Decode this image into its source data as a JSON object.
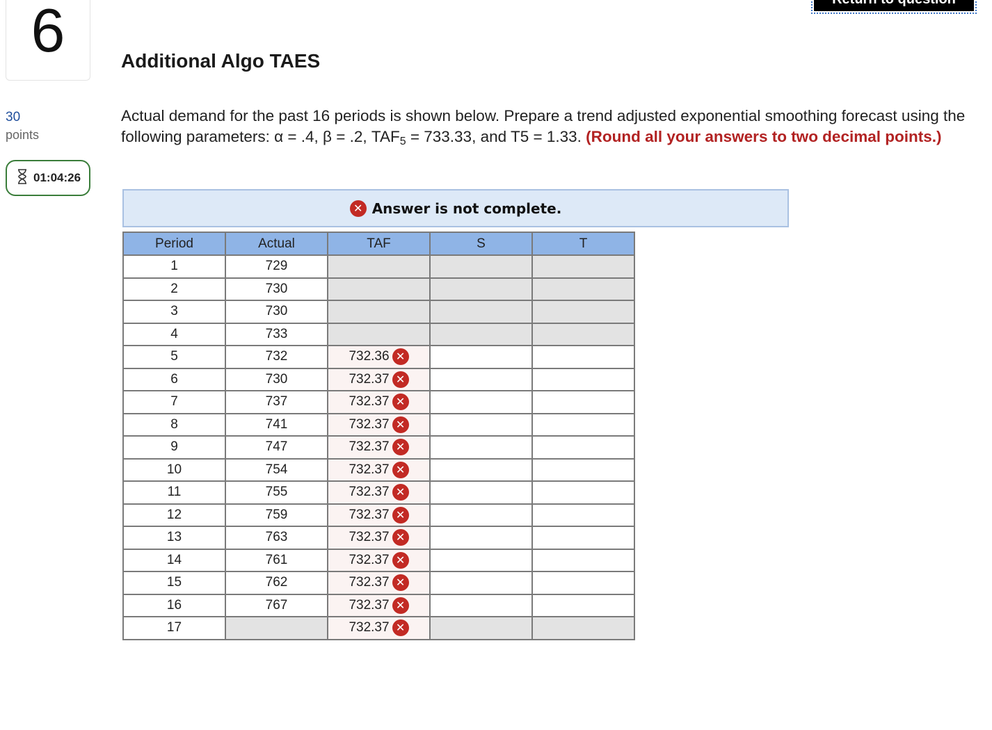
{
  "question": {
    "number": "6",
    "points_value": "30",
    "points_label": "points",
    "timer": "01:04:26",
    "title": "Additional Algo TAES",
    "prompt_main": "Actual demand for the past 16 periods is shown below. Prepare a trend adjusted exponential smoothing forecast using the following parameters: α = .4, β = .2, TAF",
    "prompt_sub": "5",
    "prompt_tail": " = 733.33, and T5 = 1.33. ",
    "prompt_emphasis": "(Round all your answers to two decimal points.)"
  },
  "return_button_label": "Return to question",
  "banner": {
    "text": "Answer is not complete."
  },
  "table": {
    "headers": [
      "Period",
      "Actual",
      "TAF",
      "S",
      "T"
    ],
    "rows": [
      {
        "period": "1",
        "actual": "729",
        "taf": ""
      },
      {
        "period": "2",
        "actual": "730",
        "taf": ""
      },
      {
        "period": "3",
        "actual": "730",
        "taf": ""
      },
      {
        "period": "4",
        "actual": "733",
        "taf": ""
      },
      {
        "period": "5",
        "actual": "732",
        "taf": "732.36"
      },
      {
        "period": "6",
        "actual": "730",
        "taf": "732.37"
      },
      {
        "period": "7",
        "actual": "737",
        "taf": "732.37"
      },
      {
        "period": "8",
        "actual": "741",
        "taf": "732.37"
      },
      {
        "period": "9",
        "actual": "747",
        "taf": "732.37"
      },
      {
        "period": "10",
        "actual": "754",
        "taf": "732.37"
      },
      {
        "period": "11",
        "actual": "755",
        "taf": "732.37"
      },
      {
        "period": "12",
        "actual": "759",
        "taf": "732.37"
      },
      {
        "period": "13",
        "actual": "763",
        "taf": "732.37"
      },
      {
        "period": "14",
        "actual": "761",
        "taf": "732.37"
      },
      {
        "period": "15",
        "actual": "762",
        "taf": "732.37"
      },
      {
        "period": "16",
        "actual": "767",
        "taf": "732.37"
      },
      {
        "period": "17",
        "actual": "",
        "taf": "732.37"
      }
    ]
  },
  "icons": {
    "incorrect": "x-circle-icon",
    "timer": "hourglass-icon"
  },
  "colors": {
    "header_bg": "#8fb4e6",
    "error_red": "#c22a24",
    "banner_bg": "#dde9f7",
    "timer_border": "#3a7d3a"
  }
}
